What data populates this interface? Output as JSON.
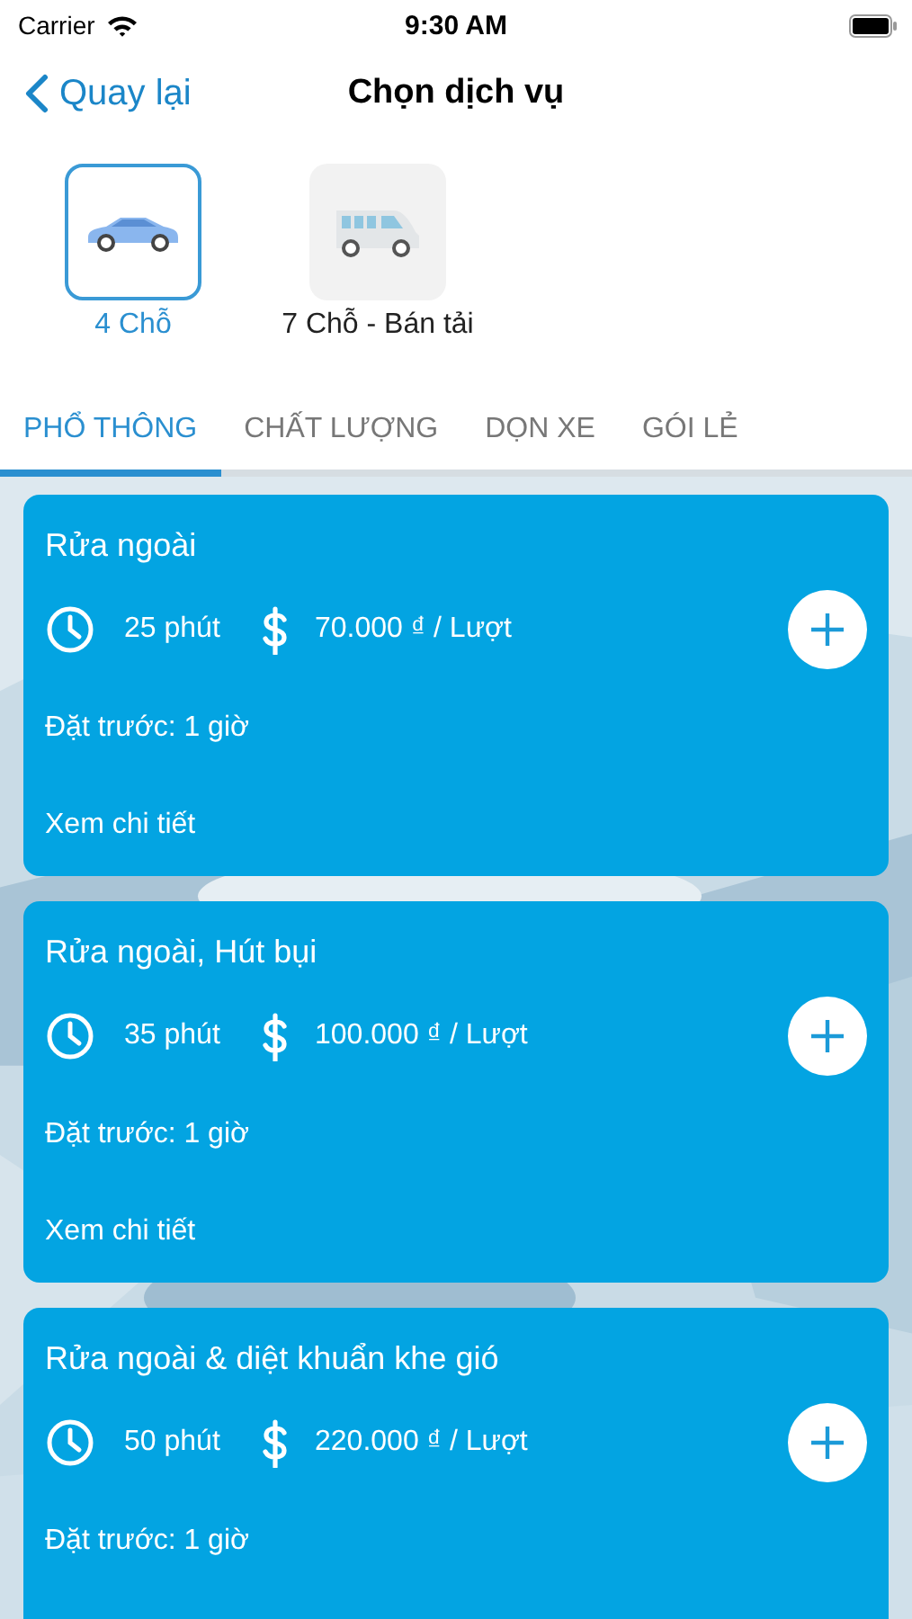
{
  "status_bar": {
    "carrier": "Carrier",
    "time": "9:30 AM"
  },
  "nav": {
    "back": "Quay lại",
    "title": "Chọn dịch vụ"
  },
  "vehicles": [
    {
      "label": "4 Chỗ",
      "kind": "car",
      "selected": true
    },
    {
      "label": "7 Chỗ - Bán tải",
      "kind": "van",
      "selected": false
    }
  ],
  "tabs": [
    {
      "label": "PHỔ THÔNG",
      "selected": true
    },
    {
      "label": "CHẤT LƯỢNG",
      "selected": false
    },
    {
      "label": "DỌN XE",
      "selected": false
    },
    {
      "label": "GÓI LẺ",
      "selected": false
    }
  ],
  "services": [
    {
      "name": "Rửa ngoài",
      "duration": "25 phút",
      "price": "70.000 ₫ / Lượt",
      "booking": "Đặt trước: 1 giờ",
      "details": "Xem chi tiết"
    },
    {
      "name": "Rửa ngoài, Hút bụi",
      "duration": "35 phút",
      "price": "100.000 ₫ / Lượt",
      "booking": "Đặt trước: 1 giờ",
      "details": "Xem chi tiết"
    },
    {
      "name": "Rửa ngoài & diệt khuẩn khe gió",
      "duration": "50 phút",
      "price": "220.000 ₫ / Lượt",
      "booking": "Đặt trước: 1 giờ"
    }
  ]
}
